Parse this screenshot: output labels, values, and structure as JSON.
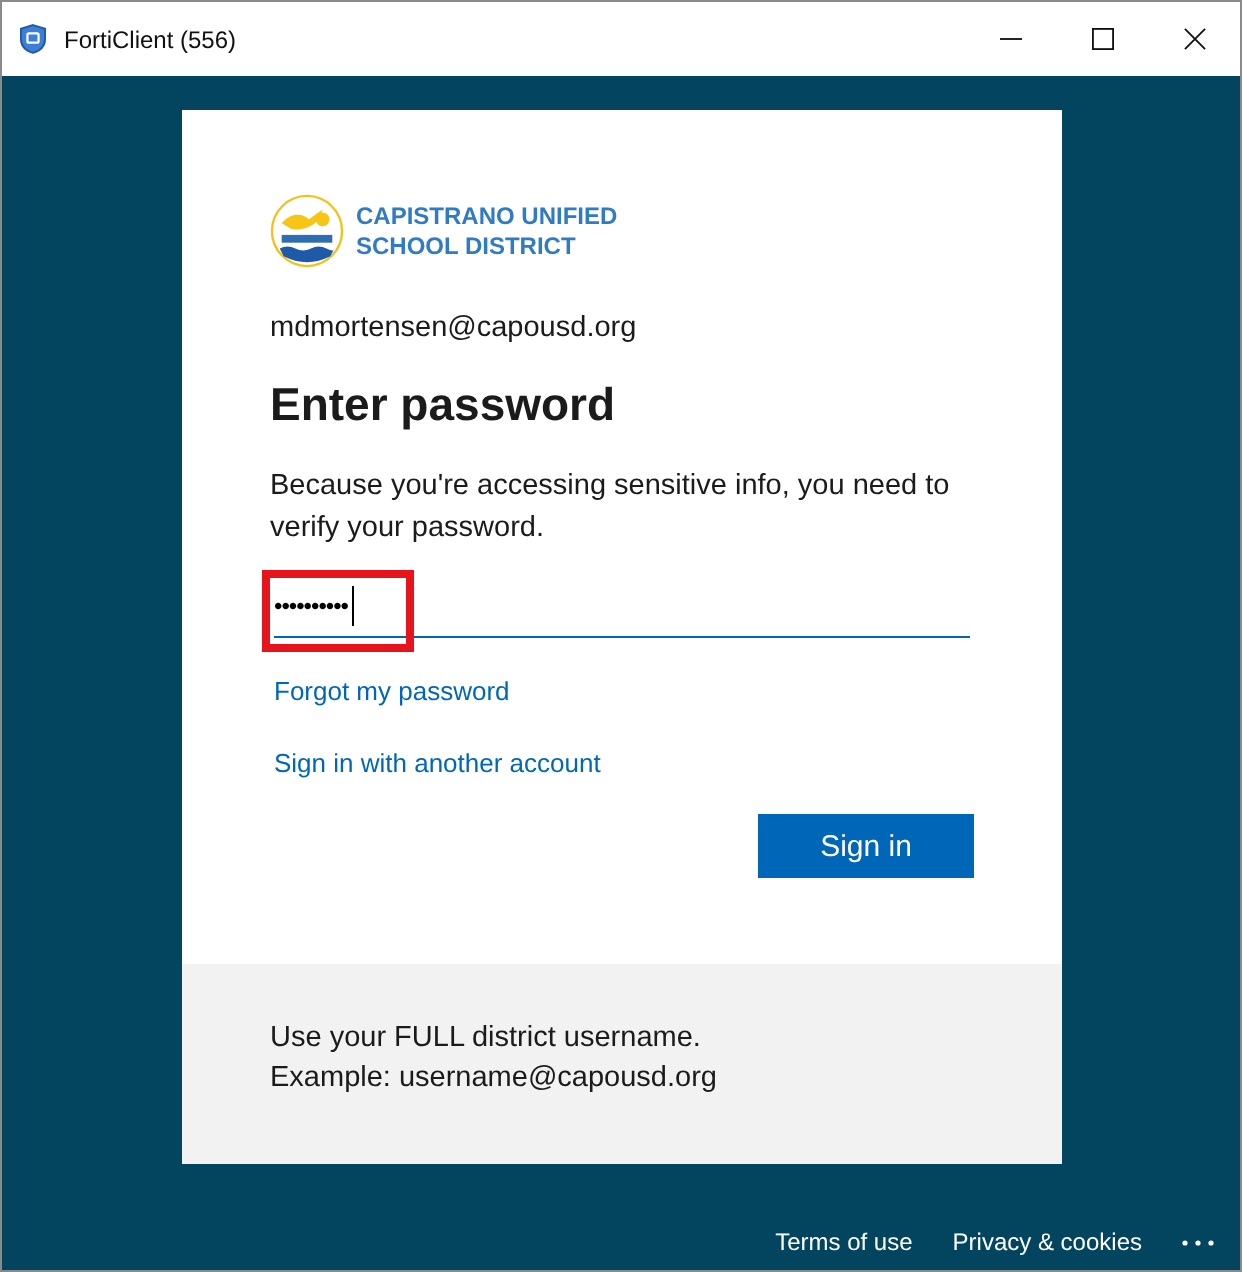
{
  "window": {
    "title": "FortiClient (556)"
  },
  "sign_in": {
    "organization": "CAPISTRANO UNIFIED SCHOOL DISTRICT",
    "account": "mdmortensen@capousd.org",
    "heading": "Enter password",
    "description": "Because you're accessing sensitive info, you need to verify your password.",
    "password_field": {
      "value": "••••••••••",
      "focused": true,
      "highlighted": true
    },
    "links": [
      "Forgot my password",
      "Sign in with another account"
    ],
    "button": "Sign in",
    "note": "Use your FULL district username. Example: username@capousd.org"
  },
  "footer_links": [
    "Terms of use",
    "Privacy & cookies"
  ]
}
